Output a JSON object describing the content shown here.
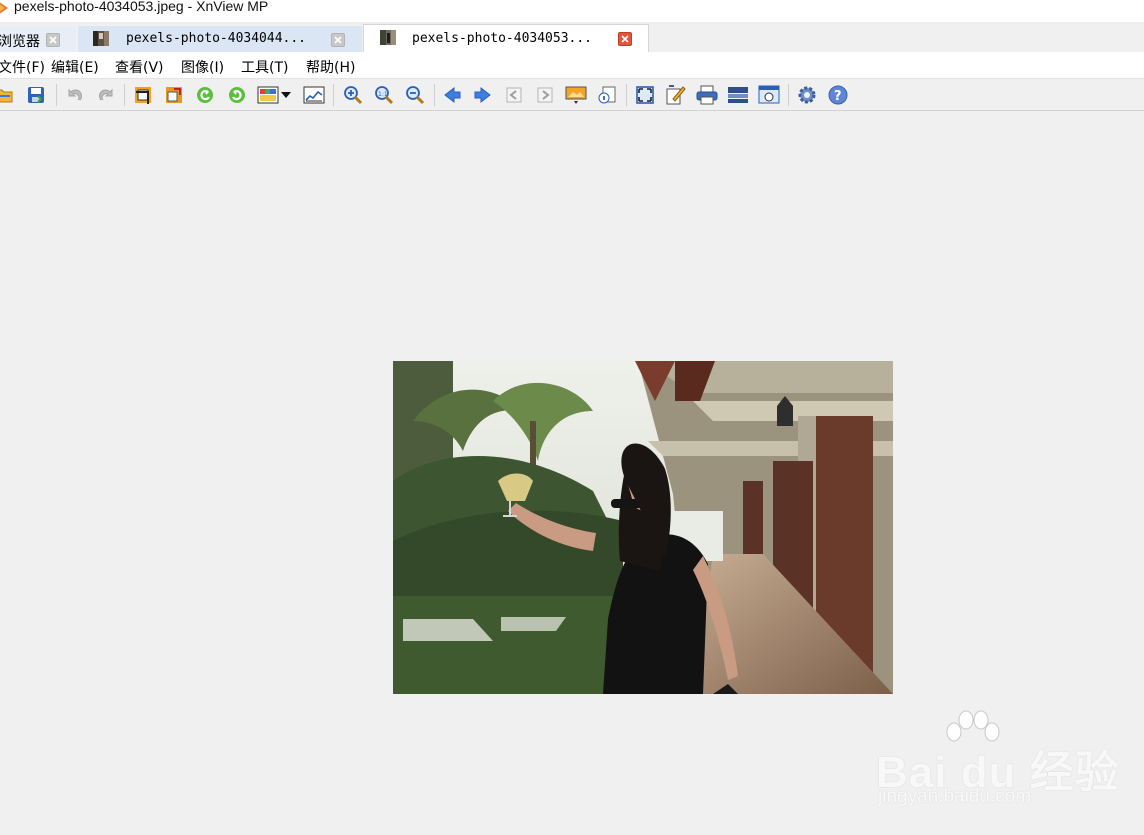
{
  "window": {
    "title": "pexels-photo-4034053.jpeg - XnView MP",
    "app_icon": "xnview-logo-icon"
  },
  "tabs": [
    {
      "label": "浏览器",
      "close_icon": "close-icon",
      "state": "inactive"
    },
    {
      "label": "pexels-photo-4034044...",
      "thumb_icon": "photo-thumbnail-icon",
      "close_icon": "close-icon",
      "state": "inactive"
    },
    {
      "label": "pexels-photo-4034053...",
      "thumb_icon": "photo-thumbnail-icon",
      "close_icon": "close-icon",
      "state": "active"
    }
  ],
  "menu": [
    {
      "label": "文件(F)"
    },
    {
      "label": "编辑(E)"
    },
    {
      "label": "查看(V)"
    },
    {
      "label": "图像(I)"
    },
    {
      "label": "工具(T)"
    },
    {
      "label": "帮助(H)"
    }
  ],
  "toolbar": {
    "icons": [
      "open-folder-icon",
      "save-icon",
      "undo-icon",
      "redo-icon",
      "crop-icon",
      "resize-icon",
      "rotate-left-icon",
      "rotate-right-icon",
      "adjust-colors-icon",
      "dropdown-arrow-icon",
      "histogram-icon",
      "zoom-in-icon",
      "zoom-actual-size-icon",
      "zoom-out-icon",
      "previous-icon",
      "next-icon",
      "first-page-icon",
      "last-page-icon",
      "slideshow-icon",
      "properties-icon",
      "fullscreen-icon",
      "edit-icon",
      "print-icon",
      "scanner-icon",
      "capture-icon",
      "settings-icon",
      "help-icon"
    ]
  },
  "viewer": {
    "image_subject": "woman-raising-glass-photo"
  },
  "watermark": {
    "brand": "Bai du 经验",
    "url": "jingyan.baidu.com"
  },
  "colors": {
    "accent_tab": "#dbe6f4",
    "close_red": "#e2553d",
    "background": "#f0f0f0"
  }
}
